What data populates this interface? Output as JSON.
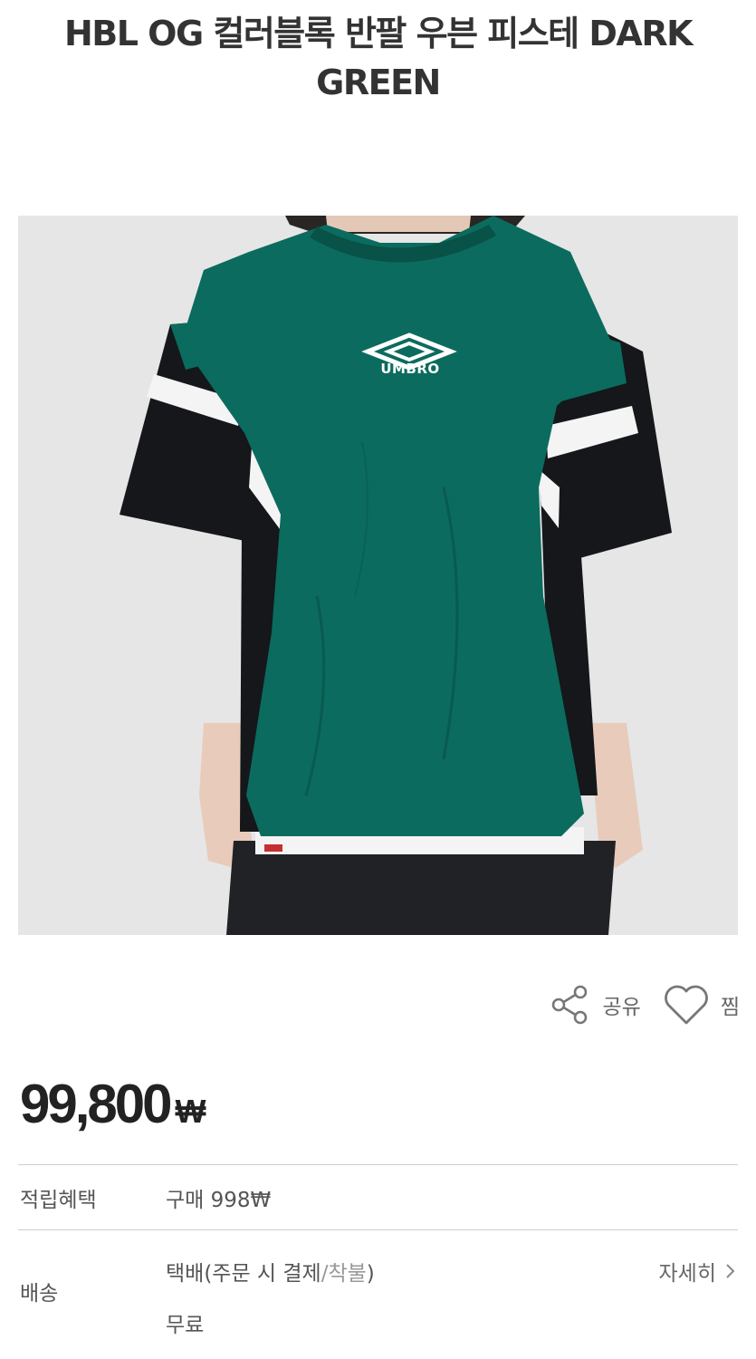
{
  "product": {
    "title": "HBL OG 컬러블록 반팔 우븐 피스테 DARK GREEN",
    "logo_text": "UMBRO",
    "price": "99,800",
    "currency": "₩"
  },
  "actions": {
    "share_label": "공유",
    "wish_label": "찜"
  },
  "benefits": {
    "points_label": "적립혜택",
    "points_value": "구매 998₩"
  },
  "shipping": {
    "label": "배송",
    "method_main": "택배(주문 시 결제",
    "method_sep": "/",
    "method_cod": "착불",
    "method_close": ")",
    "fee": "무료",
    "detail_label": "자세히",
    "detail_icon": "chevron-right-icon"
  },
  "colors": {
    "shirt_green": "#0b6b5e",
    "shirt_black": "#15171a",
    "photo_bg": "#e6e6e6"
  }
}
